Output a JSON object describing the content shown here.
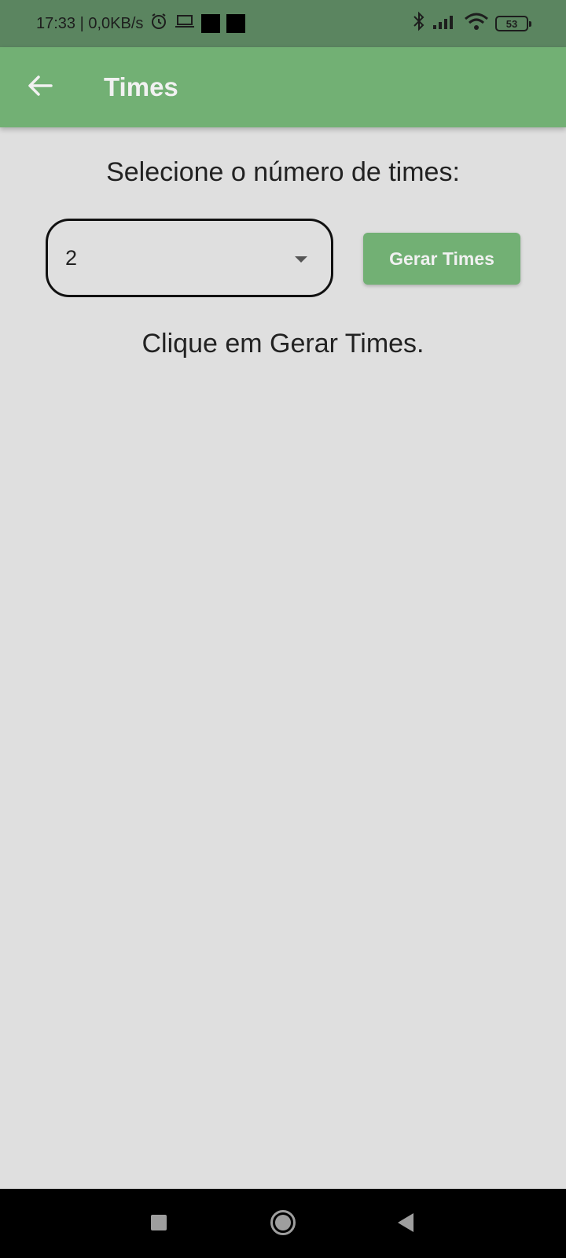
{
  "status_bar": {
    "time_speed": "17:33 | 0,0KB/s",
    "battery": "53",
    "icons": [
      "alarm-icon",
      "laptop-icon",
      "notification-square-icon",
      "notification-square-icon",
      "bluetooth-icon",
      "signal-icon",
      "wifi-icon",
      "battery-icon"
    ]
  },
  "app_bar": {
    "title": "Times",
    "back_icon": "arrow-left-icon",
    "color": "#72b074"
  },
  "main": {
    "prompt": "Selecione o número de times:",
    "dropdown": {
      "value": "2"
    },
    "generate_button": "Gerar Times",
    "hint": "Clique em Gerar Times."
  },
  "nav_bar": {
    "icons": [
      "recents-square-icon",
      "home-circle-icon",
      "back-triangle-icon"
    ]
  }
}
